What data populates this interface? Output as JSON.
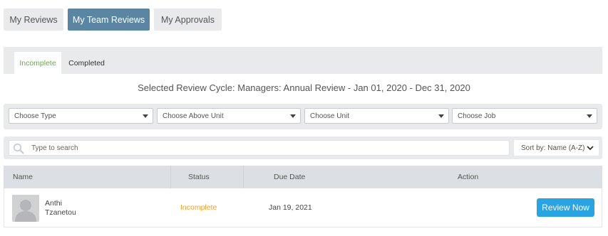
{
  "top_tabs": {
    "my_reviews": "My Reviews",
    "my_team_reviews": "My Team Reviews",
    "my_approvals": "My Approvals",
    "active": "My Team Reviews"
  },
  "sub_tabs": {
    "incomplete": "Incomplete",
    "completed": "Completed",
    "active": "Incomplete"
  },
  "review_cycle_text": "Selected Review Cycle: Managers: Annual Review - Jan 01, 2020 - Dec 31, 2020",
  "filters": {
    "type": "Choose Type",
    "above_unit": "Choose Above Unit",
    "unit": "Choose Unit",
    "job": "Choose Job"
  },
  "search": {
    "placeholder": "Type to search"
  },
  "sort": {
    "label": "Sort by: Name (A-Z)"
  },
  "table": {
    "headers": {
      "name": "Name",
      "status": "Status",
      "due_date": "Due Date",
      "action": "Action"
    },
    "rows": [
      {
        "first_name": "Anthi",
        "last_name": "Tzanetou",
        "status": "Incomplete",
        "due_date": "Jan 19, 2021",
        "action_label": "Review Now"
      }
    ]
  },
  "colors": {
    "active_tab": "#5a86a3",
    "incomplete_sub_tab": "#6aa84f",
    "status_incomplete": "#f0a12a",
    "action_button": "#2aa3e2"
  },
  "icons": {
    "search": "search-icon",
    "dropdown": "caret-down-icon",
    "sort": "chevron-down-icon",
    "avatar": "default-avatar-icon"
  }
}
